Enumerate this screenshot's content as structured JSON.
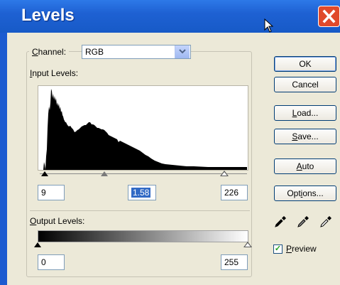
{
  "window": {
    "title": "Levels"
  },
  "channel": {
    "label_accel": "C",
    "label_rest": "hannel:",
    "value": "RGB"
  },
  "input_levels": {
    "label_accel": "I",
    "label_rest": "nput Levels:",
    "black": "9",
    "gamma": "1.58",
    "white": "226"
  },
  "output_levels": {
    "label_accel": "O",
    "label_rest": "utput Levels:",
    "black": "0",
    "white": "255"
  },
  "buttons": {
    "ok": "OK",
    "cancel": "Cancel",
    "load_accel": "L",
    "load_rest": "oad...",
    "save_accel": "S",
    "save_rest": "ave...",
    "auto_accel": "A",
    "auto_rest": "uto",
    "options_pre": "Opt",
    "options_accel": "i",
    "options_rest": "ons..."
  },
  "preview": {
    "checked": true,
    "label_accel": "P",
    "label_rest": "review"
  },
  "icons": [
    "close-icon",
    "cursor-icon",
    "dropdown-arrow-icon",
    "black-eyedropper-icon",
    "gray-eyedropper-icon",
    "white-eyedropper-icon"
  ],
  "colors": {
    "titlebar": "#1e61d3",
    "close": "#e04a2b",
    "selection": "#316ac5"
  }
}
